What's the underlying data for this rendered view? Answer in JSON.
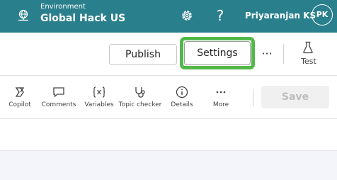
{
  "header": {
    "env_label": "Environment",
    "env_name": "Global Hack US",
    "help_glyph": "?",
    "user_name": "Priyaranjan KS",
    "user_initials": "PK",
    "colors": {
      "background": "#2a7f8c",
      "text": "#ffffff"
    }
  },
  "command_bar": {
    "publish_label": "Publish",
    "settings_label": "Settings",
    "more_glyph": "···",
    "test_label": "Test",
    "highlight_color": "#52b848"
  },
  "toolbar": {
    "items": [
      {
        "label": "Copilot",
        "icon": "copilot-icon"
      },
      {
        "label": "Comments",
        "icon": "comment-icon"
      },
      {
        "label": "Variables",
        "icon": "variables-icon"
      },
      {
        "label": "Topic checker",
        "icon": "stethoscope-icon"
      },
      {
        "label": "Details",
        "icon": "info-icon"
      },
      {
        "label": "More",
        "icon": "more-icon"
      }
    ],
    "save_label": "Save"
  }
}
